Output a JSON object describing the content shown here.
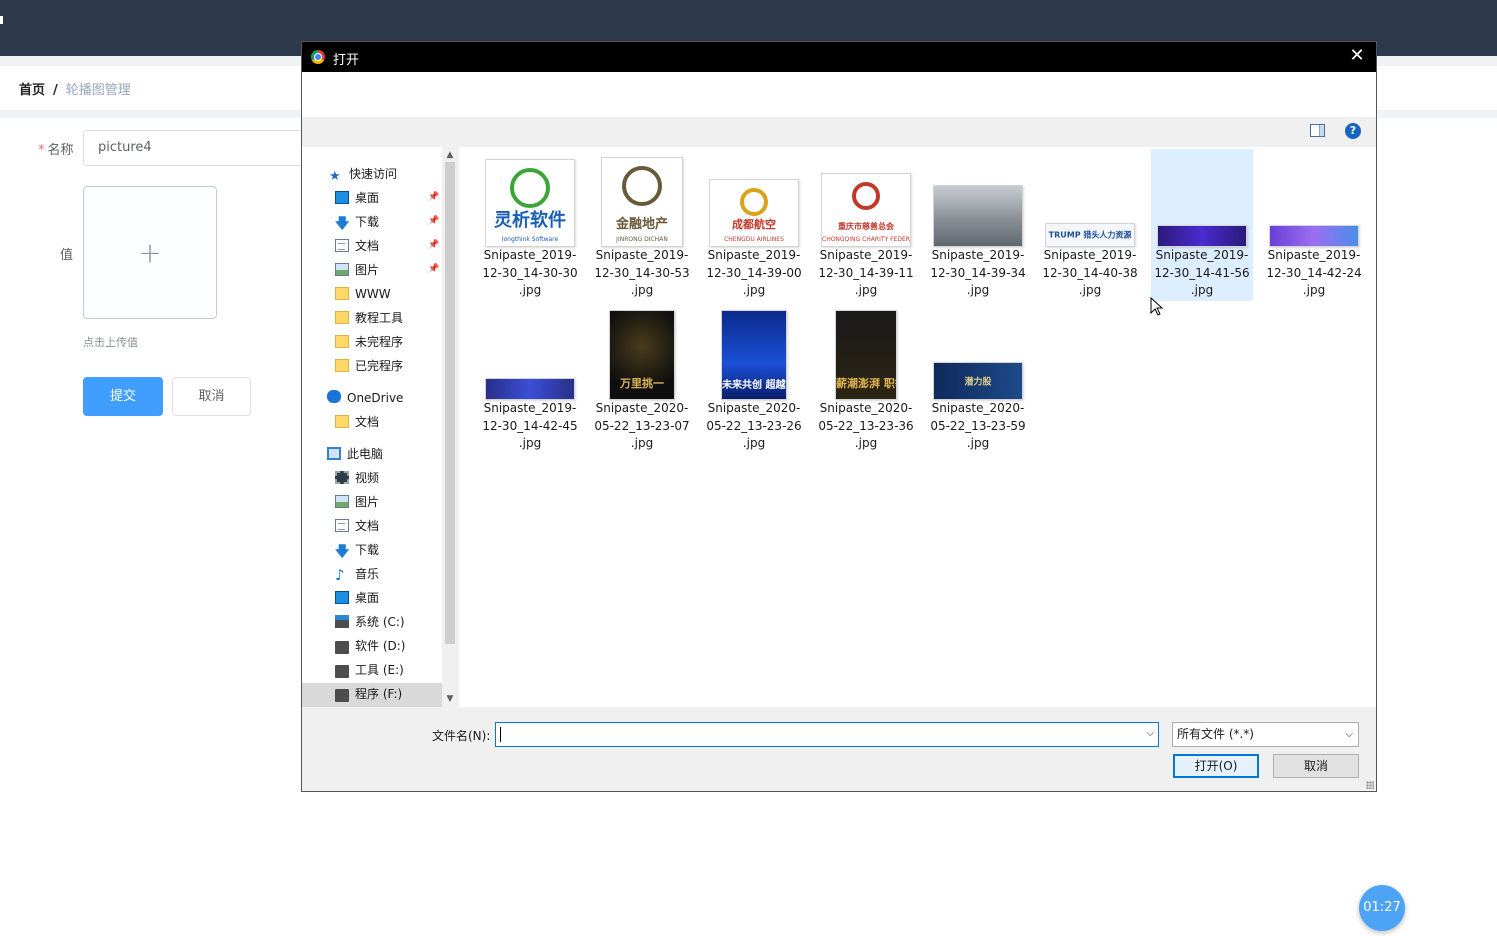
{
  "app": {
    "breadcrumb": {
      "home": "首页",
      "separator": "/",
      "current": "轮播图管理"
    },
    "form": {
      "name_required_mark": "*",
      "name_label": "名称",
      "name_value": "picture4",
      "value_label": "值",
      "upload_plus": "+",
      "upload_tip": "点击上传值",
      "submit_label": "提交",
      "cancel_label": "取消"
    },
    "timer": "01:27"
  },
  "dialog": {
    "title": "打开",
    "close_glyph": "✕",
    "help_glyph": "?",
    "nav": {
      "quick_access": "快速访问",
      "items": [
        {
          "label": "桌面",
          "icon": "desktop-icon",
          "pinned": true
        },
        {
          "label": "下载",
          "icon": "download-icon",
          "pinned": true
        },
        {
          "label": "文档",
          "icon": "document-icon",
          "pinned": true
        },
        {
          "label": "图片",
          "icon": "picture-icon",
          "pinned": true
        },
        {
          "label": "WWW",
          "icon": "folder-icon",
          "pinned": false
        },
        {
          "label": "教程工具",
          "icon": "folder-icon",
          "pinned": false
        },
        {
          "label": "未完程序",
          "icon": "folder-icon",
          "pinned": false
        },
        {
          "label": "已完程序",
          "icon": "folder-icon",
          "pinned": false
        }
      ],
      "onedrive": "OneDrive",
      "onedrive_items": [
        {
          "label": "文档",
          "icon": "folder-icon"
        }
      ],
      "this_pc": "此电脑",
      "pc_items": [
        {
          "label": "视频",
          "icon": "video-icon"
        },
        {
          "label": "图片",
          "icon": "picture-icon"
        },
        {
          "label": "文档",
          "icon": "document-icon"
        },
        {
          "label": "下载",
          "icon": "download-icon"
        },
        {
          "label": "音乐",
          "icon": "music-icon"
        },
        {
          "label": "桌面",
          "icon": "desktop-icon"
        },
        {
          "label": "系统 (C:)",
          "icon": "system-drive-icon"
        },
        {
          "label": "软件 (D:)",
          "icon": "drive-icon"
        },
        {
          "label": "工具 (E:)",
          "icon": "drive-icon"
        },
        {
          "label": "程序 (F:)",
          "icon": "drive-icon",
          "selected": true
        }
      ]
    },
    "files": [
      {
        "line1": "Snipaste_2019-",
        "line2": "12-30_14-30-30",
        "line3": ".jpg",
        "thumb_text": "灵析软件",
        "thumb_sub": "longthink Software"
      },
      {
        "line1": "Snipaste_2019-",
        "line2": "12-30_14-30-53",
        "line3": ".jpg",
        "thumb_text": "金融地产",
        "thumb_sub": "JINRONG DICHAN"
      },
      {
        "line1": "Snipaste_2019-",
        "line2": "12-30_14-39-00",
        "line3": ".jpg",
        "thumb_text": "成都航空",
        "thumb_sub": "CHENGDU AIRLINES"
      },
      {
        "line1": "Snipaste_2019-",
        "line2": "12-30_14-39-11",
        "line3": ".jpg",
        "thumb_text": "重庆市慈善总会",
        "thumb_sub": "CHONGQING CHARITY FEDERATION"
      },
      {
        "line1": "Snipaste_2019-",
        "line2": "12-30_14-39-34",
        "line3": ".jpg"
      },
      {
        "line1": "Snipaste_2019-",
        "line2": "12-30_14-40-38",
        "line3": ".jpg",
        "thumb_text": "TRUMP 猎头人力资源"
      },
      {
        "line1": "Snipaste_2019-",
        "line2": "12-30_14-41-56",
        "line3": ".jpg",
        "selected": true
      },
      {
        "line1": "Snipaste_2019-",
        "line2": "12-30_14-42-24",
        "line3": ".jpg"
      },
      {
        "line1": "Snipaste_2019-",
        "line2": "12-30_14-42-45",
        "line3": ".jpg"
      },
      {
        "line1": "Snipaste_2020-",
        "line2": "05-22_13-23-07",
        "line3": ".jpg",
        "thumb_text": "万里挑一"
      },
      {
        "line1": "Snipaste_2020-",
        "line2": "05-22_13-23-26",
        "line3": ".jpg",
        "thumb_text": "未来共创 超越梦想"
      },
      {
        "line1": "Snipaste_2020-",
        "line2": "05-22_13-23-36",
        "line3": ".jpg",
        "thumb_text": "薪潮澎湃 职等你来"
      },
      {
        "line1": "Snipaste_2020-",
        "line2": "05-22_13-23-59",
        "line3": ".jpg",
        "thumb_text": "潜力股"
      }
    ],
    "footer": {
      "filename_label": "文件名(N):",
      "filename_value": "",
      "filetype_value": "所有文件 (*.*)",
      "open_label": "打开(O)",
      "cancel_label": "取消"
    }
  },
  "colors": {
    "accent": "#409eff",
    "topbar": "#2d3a4b",
    "dialog_title": "#000000",
    "selection": "#dceeff"
  }
}
